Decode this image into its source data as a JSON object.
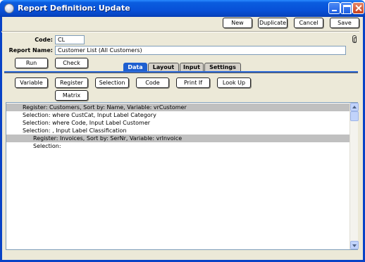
{
  "window": {
    "title": "Report Definition: Update"
  },
  "toolbar": {
    "new": "New",
    "duplicate": "Duplicate",
    "cancel": "Cancel",
    "save": "Save"
  },
  "form": {
    "code_label": "Code:",
    "code_value": "CL",
    "name_label": "Report Name:",
    "name_value": "Customer List (All Customers)"
  },
  "actions": {
    "run": "Run",
    "check": "Check"
  },
  "tabs": [
    {
      "label": "Data",
      "active": true
    },
    {
      "label": "Layout",
      "active": false
    },
    {
      "label": "Input",
      "active": false
    },
    {
      "label": "Settings",
      "active": false
    }
  ],
  "data_buttons": {
    "variable": "Variable",
    "register": "Register",
    "selection": "Selection",
    "code": "Code",
    "print_if": "Print If",
    "look_up": "Look Up",
    "matrix": "Matrix"
  },
  "rows": [
    {
      "text": "Register: Customers, Sort by: Name, Variable: vrCustomer",
      "level": 1,
      "highlighted": true
    },
    {
      "text": "Selection: where CustCat, Input Label Category",
      "level": 1,
      "highlighted": false
    },
    {
      "text": "Selection: where Code, Input Label Customer",
      "level": 1,
      "highlighted": false
    },
    {
      "text": "Selection: , Input Label Classification",
      "level": 1,
      "highlighted": false
    },
    {
      "text": "Register: Invoices, Sort by: SerNr, Variable: vrInvoice",
      "level": 2,
      "highlighted": true
    },
    {
      "text": "Selection:",
      "level": 2,
      "highlighted": false
    }
  ]
}
